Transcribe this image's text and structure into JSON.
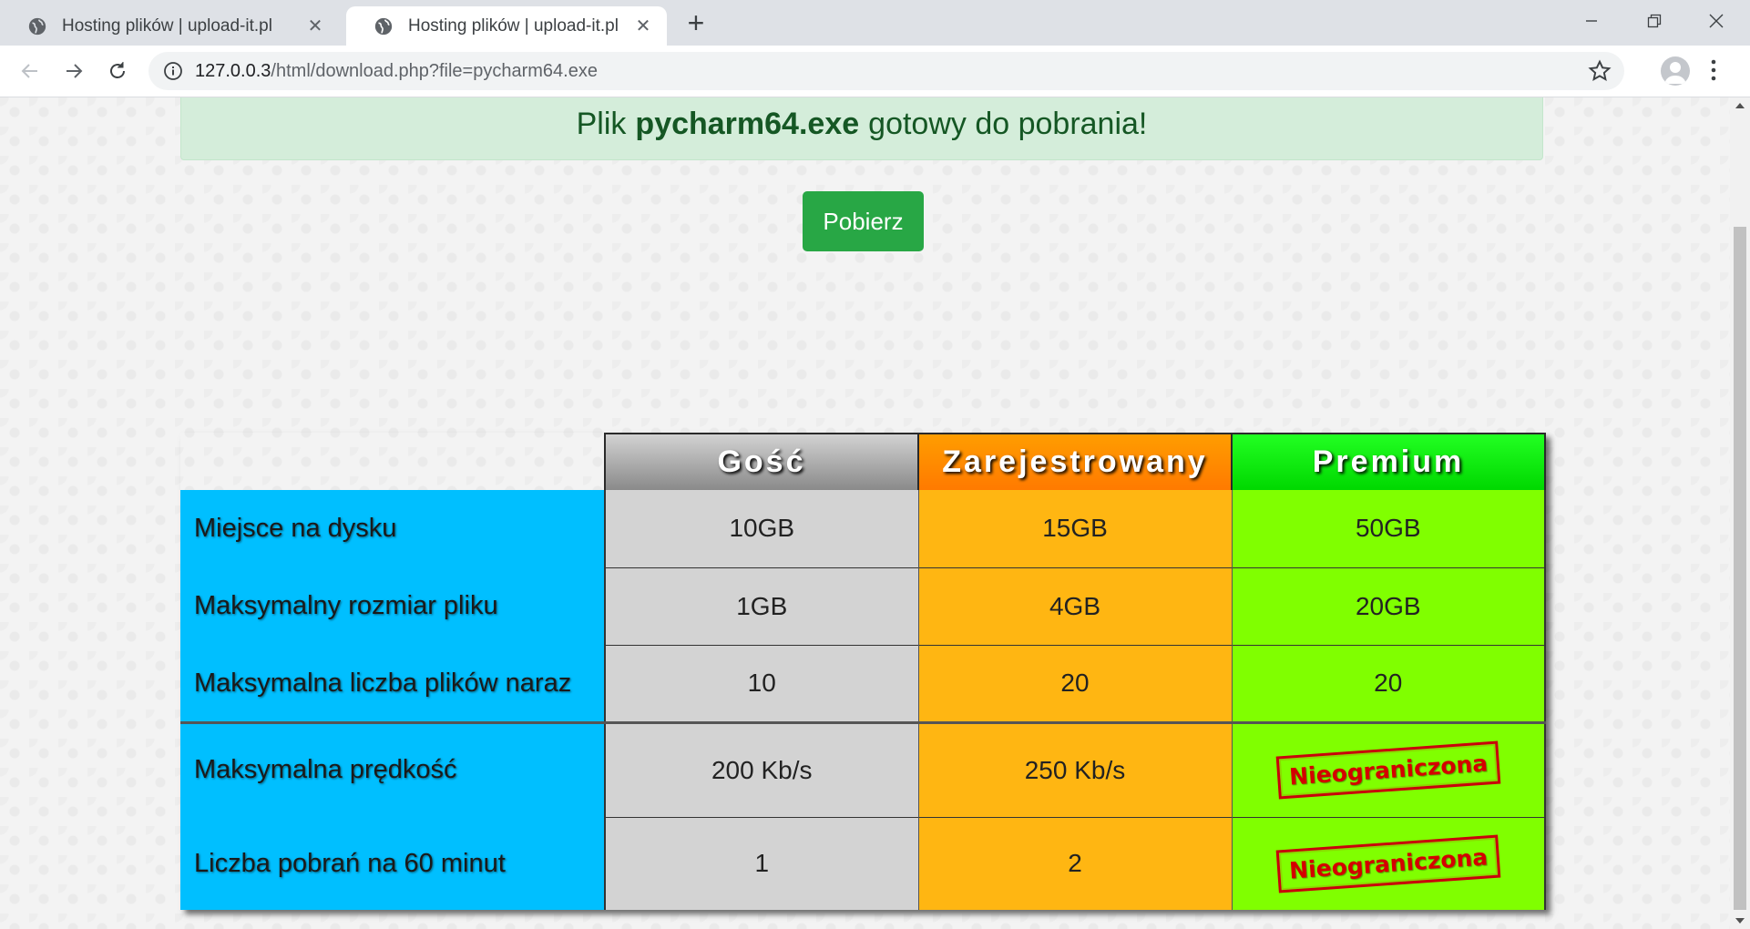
{
  "browser": {
    "tabs": [
      {
        "title": "Hosting plików | upload-it.pl",
        "active": false
      },
      {
        "title": "Hosting plików | upload-it.pl",
        "active": true
      }
    ],
    "url_host": "127.0.0.3",
    "url_path": "/html/download.php?file=pycharm64.exe"
  },
  "alert": {
    "prefix": "Plik",
    "filename": "pycharm64.exe",
    "suffix": "gotowy do pobrania!"
  },
  "download_button": "Pobierz",
  "pricing": {
    "plans": [
      "Gość",
      "Zarejestrowany",
      "Premium"
    ],
    "rows": [
      {
        "label": "Miejsce na dysku",
        "values": [
          "10GB",
          "15GB",
          "50GB"
        ]
      },
      {
        "label": "Maksymalny rozmiar pliku",
        "values": [
          "1GB",
          "4GB",
          "20GB"
        ]
      },
      {
        "label": "Maksymalna liczba plików naraz",
        "values": [
          "10",
          "20",
          "20"
        ]
      },
      {
        "label": "Maksymalna prędkość",
        "values": [
          "200 Kb/s",
          "250 Kb/s",
          "Nieograniczona"
        ]
      },
      {
        "label": "Liczba pobrań na 60 minut",
        "values": [
          "1",
          "2",
          "Nieograniczona"
        ]
      }
    ]
  },
  "colors": {
    "label_column": "#00bfff",
    "guest": "#d3d3d3",
    "registered": "#ffb612",
    "premium": "#80ff00",
    "alert_bg": "#d4edda",
    "button": "#28a745"
  }
}
